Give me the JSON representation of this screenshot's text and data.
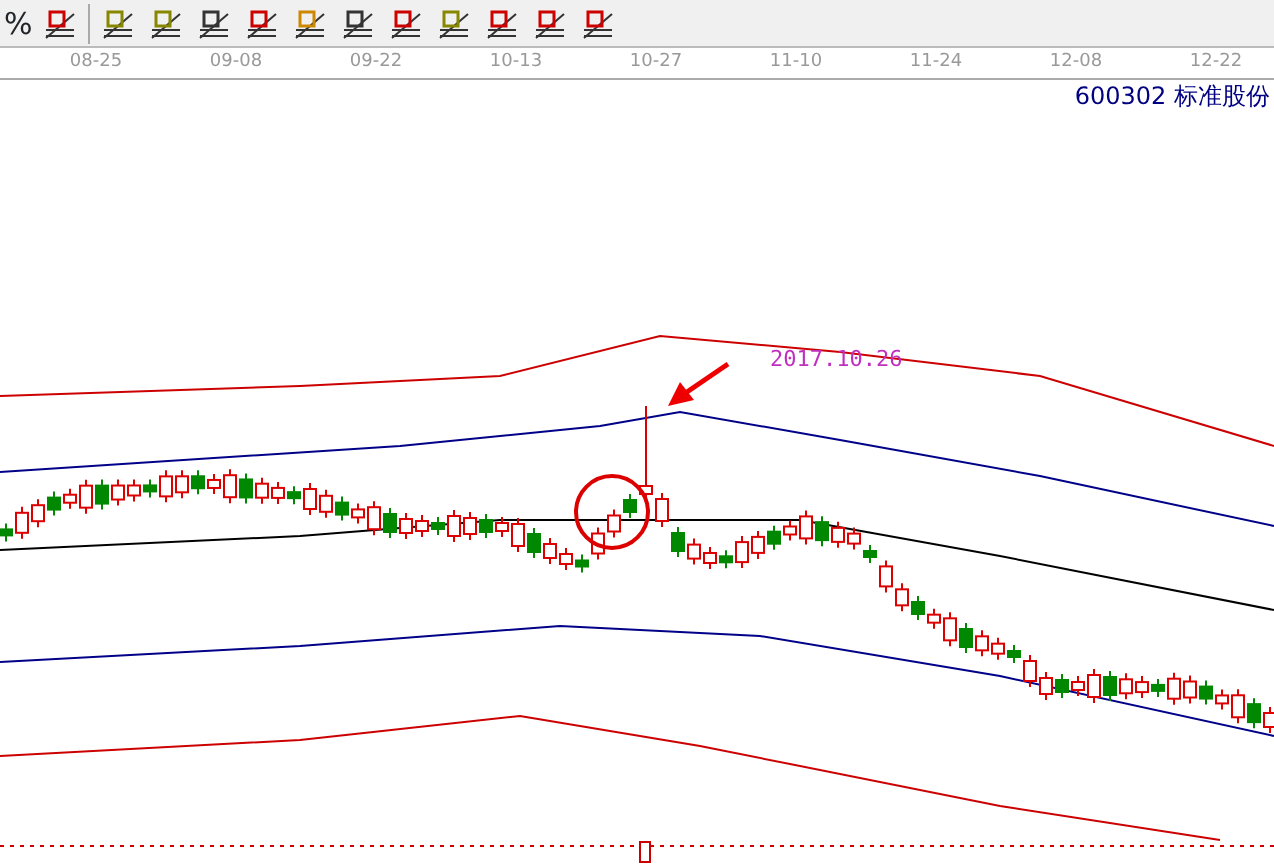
{
  "toolbar": {
    "percent_label": "%"
  },
  "date_axis": [
    "08-25",
    "09-08",
    "09-22",
    "10-13",
    "10-27",
    "11-10",
    "11-24",
    "12-08",
    "12-22"
  ],
  "stock": {
    "code": "600302",
    "name": "标准股份"
  },
  "annotation": "2017.10.26"
}
